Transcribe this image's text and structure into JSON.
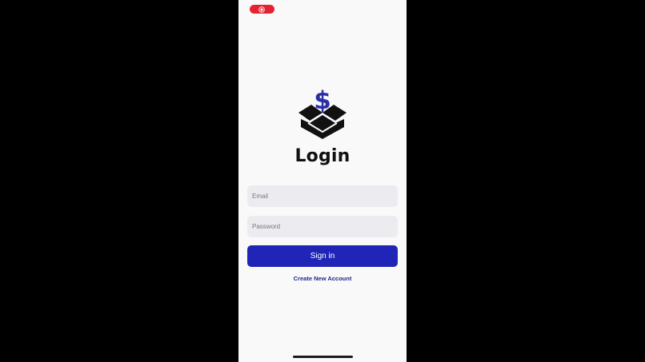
{
  "status_bar": {
    "recording_icon": "screen-recording-icon",
    "recording_color": "#e5222f"
  },
  "logo": {
    "icon": "dollar-box-icon",
    "dollar_symbol": "$",
    "dollar_color": "#2b2fa6",
    "box_color": "#111111"
  },
  "title": "Login",
  "form": {
    "email_placeholder": "Email",
    "email_value": "",
    "password_placeholder": "Password",
    "password_value": "",
    "signin_label": "Sign in",
    "signin_color": "#2025b8"
  },
  "create_account_label": "Create New Account",
  "colors": {
    "background": "#f9f9f9",
    "link": "#1e2a8c",
    "field_background": "#ececf0"
  }
}
